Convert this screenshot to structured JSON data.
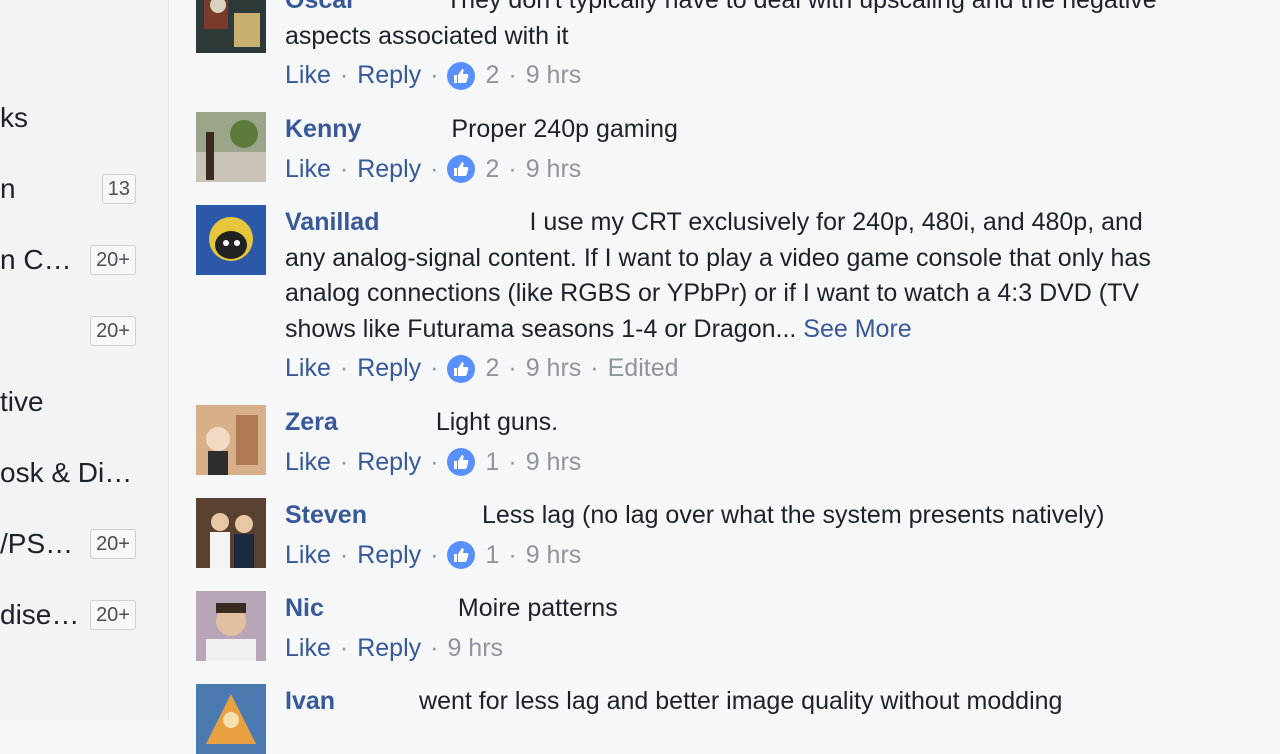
{
  "sidebar": {
    "items": [
      {
        "label": "ks",
        "badge": ""
      },
      {
        "label": "n",
        "badge": "13"
      },
      {
        "label": "n C…",
        "badge": "20+"
      },
      {
        "label": "",
        "badge": "20+"
      },
      {
        "label": "tive",
        "badge": ""
      },
      {
        "label": "osk & Di…",
        "badge": ""
      },
      {
        "label": "/PS…",
        "badge": "20+"
      },
      {
        "label": "dise…",
        "badge": "20+"
      }
    ]
  },
  "actions": {
    "like": "Like",
    "reply": "Reply",
    "separator": "·"
  },
  "comments": [
    {
      "author": "Oscar",
      "lines": [
        "They don't typically have to deal with upscaling and the negative",
        "aspects associated with it"
      ],
      "likes": "2",
      "time": "9 hrs",
      "edited": "",
      "see_more": ""
    },
    {
      "author": "Kenny",
      "lines": [
        "Proper 240p gaming"
      ],
      "likes": "2",
      "time": "9 hrs",
      "edited": "",
      "see_more": ""
    },
    {
      "author": "Vanillad",
      "lines": [
        "I use my CRT exclusively for 240p, 480i, and 480p, and",
        "any analog-signal content. If I want to play a video game console that only has",
        "analog connections (like RGBS or YPbPr) or if I want to watch a 4:3 DVD (TV",
        "shows like Futurama seasons 1-4 or Dragon..."
      ],
      "likes": "2",
      "time": "9 hrs",
      "edited": "Edited",
      "see_more": "See More"
    },
    {
      "author": "Zera",
      "lines": [
        "Light guns."
      ],
      "likes": "1",
      "time": "9 hrs",
      "edited": "",
      "see_more": ""
    },
    {
      "author": "Steven",
      "lines": [
        "Less lag (no lag over what the system presents natively)"
      ],
      "likes": "1",
      "time": "9 hrs",
      "edited": "",
      "see_more": ""
    },
    {
      "author": "Nic",
      "lines": [
        "Moire patterns"
      ],
      "likes": "",
      "time": "9 hrs",
      "edited": "",
      "see_more": ""
    },
    {
      "author": "Ivan",
      "lines": [
        "went for less lag and better image quality without modding"
      ],
      "likes": "",
      "time": "",
      "edited": "",
      "see_more": ""
    }
  ],
  "colors": {
    "link": "#385898",
    "like_badge": "#5890ff",
    "muted": "#90949c",
    "background": "#f6f7f9"
  }
}
